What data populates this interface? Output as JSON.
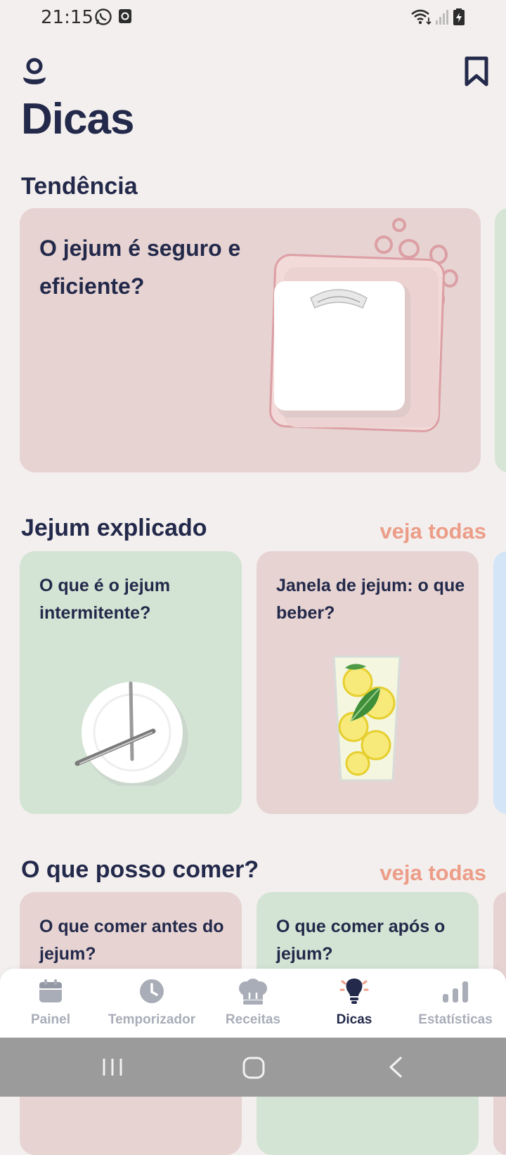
{
  "status_bar": {
    "time": "21:15"
  },
  "header": {
    "title": "Dicas"
  },
  "trending": {
    "section_title": "Tendência",
    "card_title": "O jejum é seguro e eficiente?"
  },
  "explained": {
    "section_title": "Jejum explicado",
    "see_all": "veja todas",
    "cards": [
      {
        "title": "O que é o jejum intermitente?"
      },
      {
        "title": "Janela de jejum: o que beber?"
      }
    ]
  },
  "can_eat": {
    "section_title": "O que posso comer?",
    "see_all": "veja todas",
    "cards": [
      {
        "title": "O que comer antes do jejum?"
      },
      {
        "title": "O que comer após o jejum?"
      }
    ]
  },
  "bottom_nav": {
    "active": "Dicas",
    "items": [
      {
        "label": "Painel",
        "icon": "calendar-icon"
      },
      {
        "label": "Temporizador",
        "icon": "clock-icon"
      },
      {
        "label": "Receitas",
        "icon": "chef-hat-icon"
      },
      {
        "label": "Dicas",
        "icon": "lightbulb-icon"
      },
      {
        "label": "Estatísticas",
        "icon": "bar-chart-icon"
      }
    ]
  },
  "colors": {
    "title": "#23294a",
    "accent": "#ec9d88",
    "card_pink": "#e6d3d2",
    "card_green": "#d3e4d4",
    "card_blue": "#d3e5f6",
    "nav_inactive": "#a9adb8"
  }
}
